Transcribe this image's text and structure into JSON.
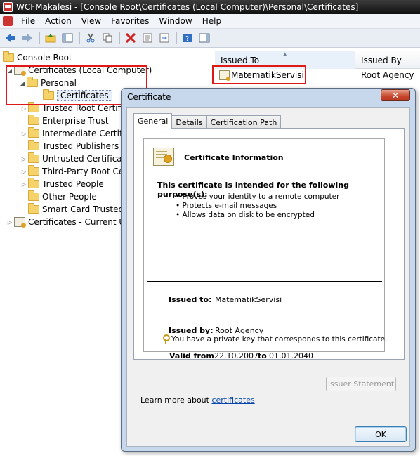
{
  "window": {
    "title": "WCFMakalesi - [Console Root\\Certificates (Local Computer)\\Personal\\Certificates]"
  },
  "menu": [
    "File",
    "Action",
    "View",
    "Favorites",
    "Window",
    "Help"
  ],
  "toolbar": {
    "icons": [
      "back-icon",
      "forward-icon",
      "up-folder-icon",
      "show-hide-tree-icon",
      "cut-icon",
      "copy-icon",
      "delete-icon",
      "properties-icon",
      "export-icon",
      "help-icon",
      "action-pane-icon"
    ]
  },
  "tree": {
    "items": [
      {
        "label": "Console Root"
      },
      {
        "label": "Certificates (Local Computer)"
      },
      {
        "label": "Personal"
      },
      {
        "label": "Certificates"
      },
      {
        "label": "Trusted Root Certific"
      },
      {
        "label": "Enterprise Trust"
      },
      {
        "label": "Intermediate Certific"
      },
      {
        "label": "Trusted Publishers"
      },
      {
        "label": "Untrusted Certificate"
      },
      {
        "label": "Third-Party Root Cer"
      },
      {
        "label": "Trusted People"
      },
      {
        "label": "Other People"
      },
      {
        "label": "Smart Card Trusted R"
      },
      {
        "label": "Certificates - Current Us"
      }
    ]
  },
  "list": {
    "columns": [
      "Issued To",
      "Issued By"
    ],
    "rows": [
      {
        "issued_to": "MatematikServisi",
        "issued_by": "Root Agency"
      }
    ]
  },
  "dialog": {
    "title": "Certificate",
    "close": "✕",
    "tabs": [
      "General",
      "Details",
      "Certification Path"
    ],
    "info_title": "Certificate Information",
    "purpose_heading": "This certificate is intended for the following purpose(s):",
    "purposes": [
      "• Proves your identity to a remote computer",
      "• Protects e-mail messages",
      "• Allows data on disk to be encrypted"
    ],
    "issued_to_label": "Issued to:",
    "issued_to_value": "MatematikServisi",
    "issued_by_label": "Issued by:",
    "issued_by_value": "Root Agency",
    "valid_from_label": "Valid from",
    "valid_from_value": "22.10.2007",
    "valid_to_label": "to",
    "valid_to_value": "01.01.2040",
    "private_key_note": "You have a private key that corresponds to this certificate.",
    "issuer_statement_button": "Issuer Statement",
    "learn_more_prefix": "Learn more about",
    "learn_more_link": "certificates",
    "ok_button": "OK"
  },
  "colors": {
    "highlight_box": "#e01818",
    "dialog_frame": "#c7d8ec",
    "link": "#0645ad"
  }
}
